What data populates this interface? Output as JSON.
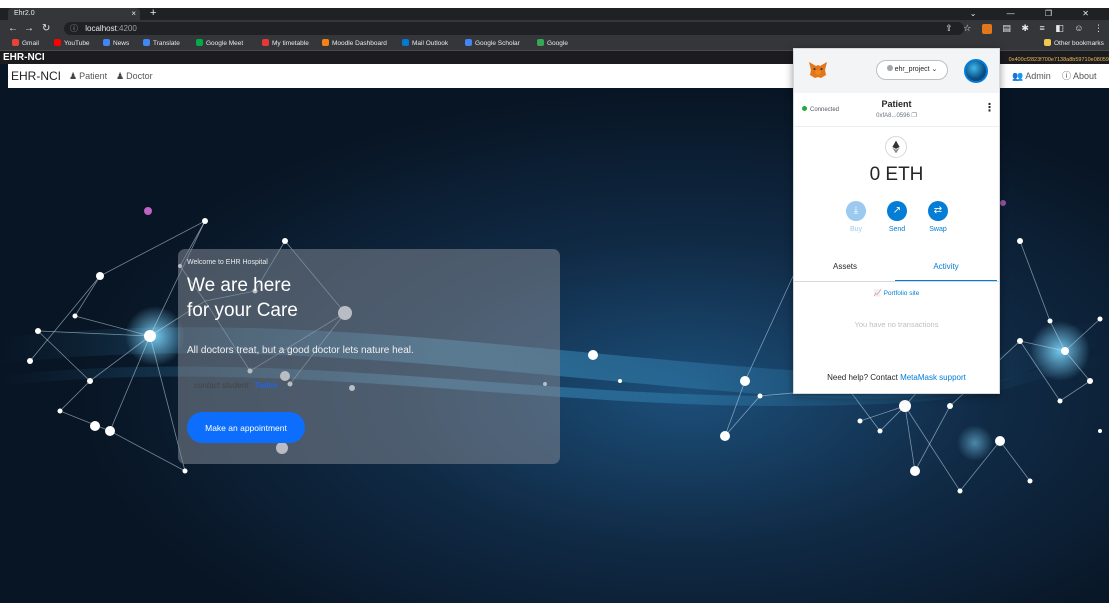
{
  "browser": {
    "tab_title": "Ehr2.0",
    "tab_close": "×",
    "new_tab": "+",
    "window_controls": "⌄ — ❐ ✕",
    "url_host": "localhost",
    "url_port": ":4200",
    "bookmarks": [
      {
        "label": "Gmail",
        "color": "#ea4335"
      },
      {
        "label": "YouTube",
        "color": "#ff0000"
      },
      {
        "label": "News",
        "color": "#4285f4"
      },
      {
        "label": "Translate",
        "color": "#4285f4"
      },
      {
        "label": "Google Meet",
        "color": "#00ac47"
      },
      {
        "label": "My timetable",
        "color": "#e53935"
      },
      {
        "label": "Moodle Dashboard",
        "color": "#f98012"
      },
      {
        "label": "Mail Outlook",
        "color": "#0078d4"
      },
      {
        "label": "Google Scholar",
        "color": "#4285f4"
      },
      {
        "label": "Google",
        "color": "#34a853"
      }
    ],
    "other_bookmarks": "Other bookmarks"
  },
  "app": {
    "title": "EHR-NCI",
    "hash": "0x400cf2823f700e7138a8b59710e08059",
    "navbar": {
      "brand": "EHR-NCI",
      "links": {
        "patient": "Patient",
        "doctor": "Doctor",
        "admin": "Admin",
        "about": "About"
      }
    },
    "hero": {
      "welcome": "Welcome to EHR Hospital",
      "headline_line1": "We are here",
      "headline_line2": "for your Care",
      "quote": "All doctors treat, but a good doctor lets nature heal.",
      "contact_label": "contact student:",
      "contact_link": "Twitter",
      "appointment_button": "Make an appointment"
    }
  },
  "metamask": {
    "network": "ehr_project",
    "status": "Connected",
    "account_name": "Patient",
    "account_address": "0xfA8...0596",
    "balance": "0 ETH",
    "actions": {
      "buy": "Buy",
      "send": "Send",
      "swap": "Swap"
    },
    "tabs": {
      "assets": "Assets",
      "activity": "Activity"
    },
    "portfolio_link": "Portfolio site",
    "empty_activity": "You have no transactions",
    "help_text": "Need help? Contact ",
    "help_link": "MetaMask support"
  }
}
